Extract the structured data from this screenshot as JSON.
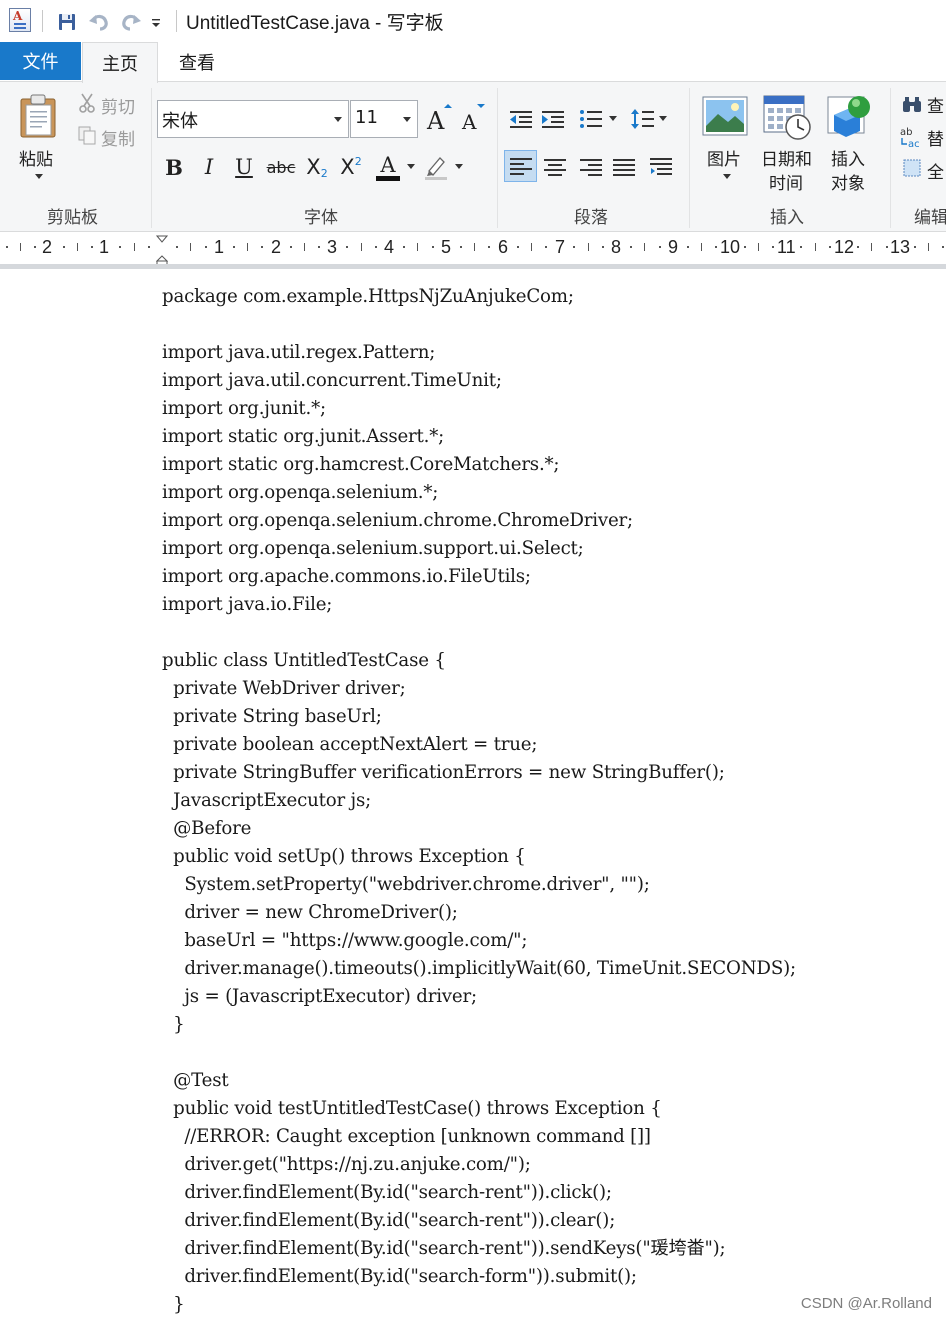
{
  "window": {
    "title": "UntitledTestCase.java - 写字板"
  },
  "quick_access": {
    "save_icon": "save-icon",
    "undo_icon": "undo-icon",
    "redo_icon": "redo-icon",
    "customize_icon": "customize-dropdown-icon"
  },
  "tabs": {
    "file": "文件",
    "home": "主页",
    "view": "查看"
  },
  "ribbon": {
    "clipboard": {
      "group_label": "剪贴板",
      "paste": "粘贴",
      "cut": "剪切",
      "copy": "复制"
    },
    "font": {
      "group_label": "字体",
      "font_family": "宋体",
      "font_size": "11",
      "bold": "B",
      "italic": "I",
      "underline": "U",
      "strike": "abc",
      "subscript": "X",
      "superscript": "X",
      "color_letter": "A"
    },
    "paragraph": {
      "group_label": "段落"
    },
    "insert": {
      "group_label": "插入",
      "picture_label": "图片",
      "datetime_line1": "日期和",
      "datetime_line2": "时间",
      "object_line1": "插入",
      "object_line2": "对象"
    },
    "edit": {
      "group_label": "编辑",
      "find": "查",
      "replace": "替",
      "select_all": "全"
    }
  },
  "ruler": {
    "numbers": [
      "2",
      "1",
      "1",
      "2",
      "3",
      "4",
      "5",
      "6",
      "7",
      "8",
      "9",
      "10",
      "11",
      "12",
      "13"
    ]
  },
  "document": {
    "lines": [
      "package com.example.HttpsNjZuAnjukeCom;",
      "",
      "import java.util.regex.Pattern;",
      "import java.util.concurrent.TimeUnit;",
      "import org.junit.*;",
      "import static org.junit.Assert.*;",
      "import static org.hamcrest.CoreMatchers.*;",
      "import org.openqa.selenium.*;",
      "import org.openqa.selenium.chrome.ChromeDriver;",
      "import org.openqa.selenium.support.ui.Select;",
      "import org.apache.commons.io.FileUtils;",
      "import java.io.File;",
      "",
      "public class UntitledTestCase {",
      "  private WebDriver driver;",
      "  private String baseUrl;",
      "  private boolean acceptNextAlert = true;",
      "  private StringBuffer verificationErrors = new StringBuffer();",
      "  JavascriptExecutor js;",
      "  @Before",
      "  public void setUp() throws Exception {",
      "    System.setProperty(\"webdriver.chrome.driver\", \"\");",
      "    driver = new ChromeDriver();",
      "    baseUrl = \"https://www.google.com/\";",
      "    driver.manage().timeouts().implicitlyWait(60, TimeUnit.SECONDS);",
      "    js = (JavascriptExecutor) driver;",
      "  }",
      "",
      "  @Test",
      "  public void testUntitledTestCase() throws Exception {",
      "    //ERROR: Caught exception [unknown command []]",
      "    driver.get(\"https://nj.zu.anjuke.com/\");",
      "    driver.findElement(By.id(\"search-rent\")).click();",
      "    driver.findElement(By.id(\"search-rent\")).clear();",
      "    driver.findElement(By.id(\"search-rent\")).sendKeys(\"瑗垮畨\");",
      "    driver.findElement(By.id(\"search-form\")).submit();",
      "  }"
    ]
  },
  "watermark": "CSDN @Ar.Rolland",
  "colors": {
    "file_tab": "#1979ca",
    "ribbon_bg": "#f5f6f7",
    "active_button": "#c5dcf1"
  }
}
